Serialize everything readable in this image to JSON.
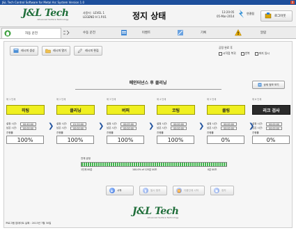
{
  "window": {
    "title": "J&L Tech  Control Software for Metal Arc System Version 1.0",
    "close": "X"
  },
  "header": {
    "logo_main": "J&L Tech",
    "logo_sub": "Advanced Surface Technology",
    "user_level": "사용자 : LEVEL 1",
    "version": "LEGEND H 1.P.01",
    "status_title": "정지 상태",
    "time": "13:20:05",
    "date": "05-Mar-2014",
    "alarm_label": "연결됨",
    "logout_label": "로그아웃"
  },
  "tabs": [
    {
      "label": "자동 운전",
      "icon": "home-icon",
      "active": true
    },
    {
      "label": "수동 운전",
      "icon": "manual-icon",
      "active": false
    },
    {
      "label": "이벤트",
      "icon": "event-icon",
      "active": false
    },
    {
      "label": "기록",
      "icon": "record-icon",
      "active": false
    },
    {
      "label": "알람",
      "icon": "warning-icon",
      "active": false
    }
  ],
  "toolbar": {
    "recipe_create": "레시피 생성",
    "recipe_open": "레시피 열기",
    "recipe_edit": "레시피 편집"
  },
  "options": {
    "title": "공정 완료 후",
    "items": [
      "시작점 복귀",
      "반복",
      "퍼지 일시"
    ]
  },
  "mode_title": "메인터넌스 후 클리닝",
  "detail_button": "상세 정보 보기",
  "stages": [
    {
      "step": "제 1 단계",
      "name": "히팅",
      "set_label": "설정 시간:",
      "set": "00:40:00",
      "elapsed_label": "남은 시간:",
      "elapsed": "00:00:00",
      "progress_label": "진행률",
      "progress": "100%",
      "dark": false
    },
    {
      "step": "제 2 단계",
      "name": "클리닝",
      "set_label": "설정 시간:",
      "set": "01:20:00",
      "elapsed_label": "남은 시간:",
      "elapsed": "00:00:00",
      "progress_label": "진행률",
      "progress": "100%",
      "dark": false
    },
    {
      "step": "제 3 단계",
      "name": "버퍼",
      "set_label": "설정 시간:",
      "set": "00:05:00",
      "elapsed_label": "남은 시간:",
      "elapsed": "00:00:00",
      "progress_label": "진행률",
      "progress": "100%",
      "dark": false
    },
    {
      "step": "제 4 단계",
      "name": "코팅",
      "set_label": "설정 시간:",
      "set": "00:00:00",
      "elapsed_label": "남은 시간:",
      "elapsed": "00:00:00",
      "progress_label": "진행률",
      "progress": "100%",
      "dark": false
    },
    {
      "step": "제 5 단계",
      "name": "쿨링",
      "set_label": "설정 시간:",
      "set": "00:00:00",
      "elapsed_label": "남은 시간:",
      "elapsed": "00:00:00",
      "progress_label": "진행률",
      "progress": "0%",
      "dark": false
    },
    {
      "step": "제 6 단계",
      "name": "리크 검사",
      "set_label": "설정 시간:",
      "set": "00:00:00",
      "elapsed_label": "남은 시간:",
      "elapsed": "00:00:00",
      "progress_label": "진행률",
      "progress": "0%",
      "dark": true
    }
  ],
  "overall": {
    "label": "전체 공정",
    "fraction": 1.0,
    "start": "1단계 00분",
    "middle": "100.0% of 125분 00초",
    "end": "0분 00초"
  },
  "controls": {
    "start": "시작",
    "pause": "일시 정지",
    "next": "다음단계 시작",
    "stop": "정지"
  },
  "footer": {
    "program_date": "프로그램 업데이트 날짜 : 2013년 7월 30일"
  }
}
